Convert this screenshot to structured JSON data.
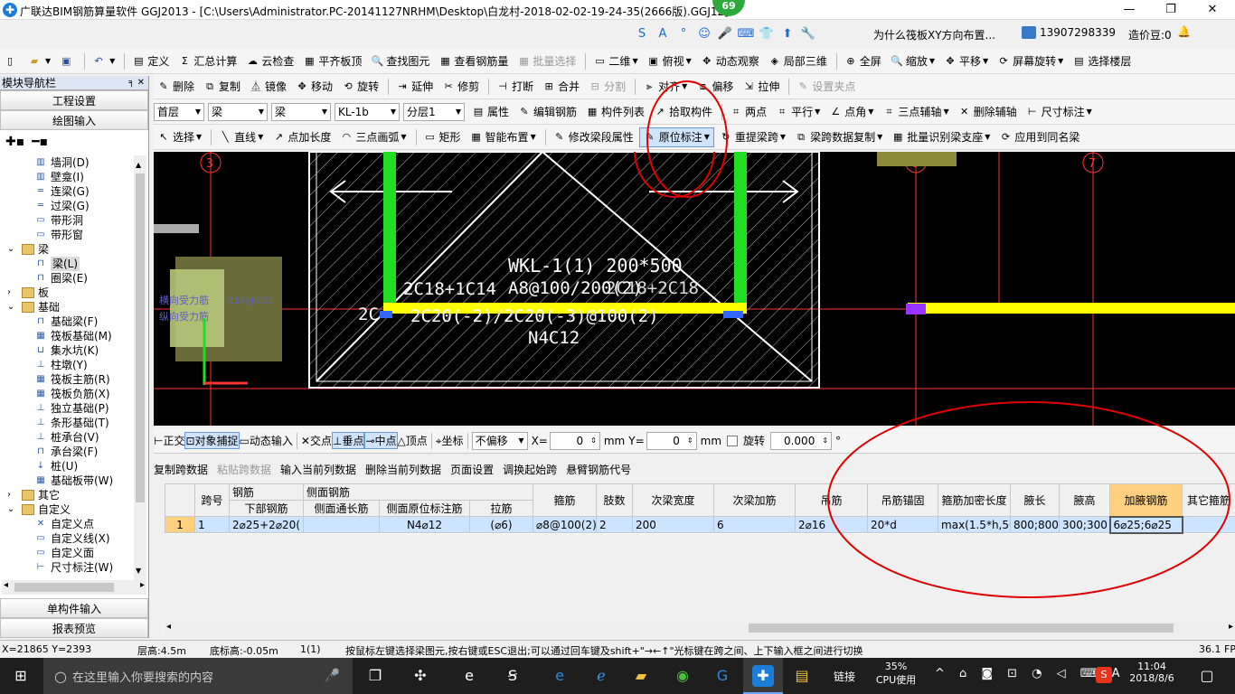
{
  "window": {
    "title": "广联达BIM钢筋算量软件 GGJ2013 - [C:\\Users\\Administrator.PC-20141127NRHM\\Desktop\\白龙村-2018-02-02-19-24-35(2666版).GGJ12]",
    "badge": "69",
    "min": "—",
    "max": "❐",
    "close": "✕"
  },
  "ime": {
    "icons": [
      "S",
      "A",
      "°",
      "☺",
      "🎤",
      "⌨",
      "👕",
      "⬆",
      "🔧"
    ]
  },
  "top_right": {
    "question": "为什么筏板XY方向布置...",
    "phone": "13907298339",
    "beans": "造价豆:0"
  },
  "menu": {
    "items": [
      {
        "label": "定义",
        "icon": "▤"
      },
      {
        "label": "汇总计算",
        "icon": "Σ"
      },
      {
        "label": "云检查",
        "icon": "☁"
      },
      {
        "label": "平齐板顶",
        "icon": "▦"
      },
      {
        "label": "查找图元",
        "icon": "🔍"
      },
      {
        "label": "查看钢筋量",
        "icon": "▦"
      },
      {
        "label": "批量选择",
        "icon": "▦"
      },
      {
        "label": "二维",
        "icon": "▭"
      },
      {
        "label": "俯视",
        "icon": "▣"
      },
      {
        "label": "动态观察",
        "icon": "✥"
      },
      {
        "label": "局部三维",
        "icon": "◈"
      },
      {
        "label": "全屏",
        "icon": "⊕"
      },
      {
        "label": "缩放",
        "icon": "🔍"
      },
      {
        "label": "平移",
        "icon": "✥"
      },
      {
        "label": "屏幕旋转",
        "icon": "⟳"
      },
      {
        "label": "选择楼层",
        "icon": "▤"
      }
    ]
  },
  "edit": {
    "items": [
      {
        "label": "删除",
        "icon": "✎"
      },
      {
        "label": "复制",
        "icon": "⧉"
      },
      {
        "label": "镜像",
        "icon": "⏅"
      },
      {
        "label": "移动",
        "icon": "✥"
      },
      {
        "label": "旋转",
        "icon": "⟲"
      },
      {
        "label": "延伸",
        "icon": "⇥"
      },
      {
        "label": "修剪",
        "icon": "✂"
      },
      {
        "label": "打断",
        "icon": "⊣"
      },
      {
        "label": "合并",
        "icon": "⊞"
      },
      {
        "label": "分割",
        "icon": "⊟"
      },
      {
        "label": "对齐",
        "icon": "⫸"
      },
      {
        "label": "偏移",
        "icon": "⧈"
      },
      {
        "label": "拉伸",
        "icon": "⇲"
      },
      {
        "label": "设置夹点",
        "icon": "✎"
      }
    ]
  },
  "props": {
    "floor": "首层",
    "cat1": "梁",
    "cat2": "梁",
    "comp": "KL-1b",
    "layer": "分层1",
    "items": [
      {
        "label": "属性",
        "icon": "▤"
      },
      {
        "label": "编辑钢筋",
        "icon": "✎"
      },
      {
        "label": "构件列表",
        "icon": "▦"
      },
      {
        "label": "拾取构件",
        "icon": "↗"
      },
      {
        "label": "两点",
        "icon": "⌗"
      },
      {
        "label": "平行",
        "icon": "⌗"
      },
      {
        "label": "点角",
        "icon": "∠"
      },
      {
        "label": "三点辅轴",
        "icon": "⌗"
      },
      {
        "label": "删除辅轴",
        "icon": "✕"
      },
      {
        "label": "尺寸标注",
        "icon": "⊢"
      }
    ]
  },
  "draw": {
    "items": [
      {
        "label": "选择",
        "icon": "↖"
      },
      {
        "label": "直线",
        "icon": "╲"
      },
      {
        "label": "点加长度",
        "icon": "↗"
      },
      {
        "label": "三点画弧",
        "icon": "◠"
      },
      {
        "label": "矩形",
        "icon": "▭"
      },
      {
        "label": "智能布置",
        "icon": "▦"
      },
      {
        "label": "修改梁段属性",
        "icon": "✎"
      },
      {
        "label": "原位标注",
        "icon": "✎"
      },
      {
        "label": "重提梁跨",
        "icon": "↻"
      },
      {
        "label": "梁跨数据复制",
        "icon": "⧉"
      },
      {
        "label": "批量识别梁支座",
        "icon": "▦"
      },
      {
        "label": "应用到同名梁",
        "icon": "⟳"
      }
    ]
  },
  "nav": {
    "title": "模块导航栏",
    "pin": "╕ ✕",
    "btn1": "工程设置",
    "btn2": "绘图输入",
    "btn3": "单构件输入",
    "btn4": "报表预览",
    "tree": [
      {
        "label": "墙洞(D)",
        "icon": "▥",
        "indent": 2
      },
      {
        "label": "壁龛(I)",
        "icon": "▥",
        "indent": 2
      },
      {
        "label": "连梁(G)",
        "icon": "═",
        "indent": 2
      },
      {
        "label": "过梁(G)",
        "icon": "═",
        "indent": 2
      },
      {
        "label": "带形洞",
        "icon": "▭",
        "indent": 2
      },
      {
        "label": "带形窗",
        "icon": "▭",
        "indent": 2
      },
      {
        "label": "梁",
        "icon": "",
        "indent": 1,
        "folder": true,
        "toggle": "⌄"
      },
      {
        "label": "梁(L)",
        "icon": "⊓",
        "indent": 2,
        "sel": true
      },
      {
        "label": "圈梁(E)",
        "icon": "⊓",
        "indent": 2
      },
      {
        "label": "板",
        "icon": "",
        "indent": 1,
        "folder": true,
        "toggle": "›"
      },
      {
        "label": "基础",
        "icon": "",
        "indent": 1,
        "folder": true,
        "toggle": "⌄"
      },
      {
        "label": "基础梁(F)",
        "icon": "⊓",
        "indent": 2
      },
      {
        "label": "筏板基础(M)",
        "icon": "▦",
        "indent": 2
      },
      {
        "label": "集水坑(K)",
        "icon": "⊔",
        "indent": 2
      },
      {
        "label": "柱墩(Y)",
        "icon": "⊥",
        "indent": 2
      },
      {
        "label": "筏板主筋(R)",
        "icon": "▦",
        "indent": 2
      },
      {
        "label": "筏板负筋(X)",
        "icon": "▦",
        "indent": 2
      },
      {
        "label": "独立基础(P)",
        "icon": "⊥",
        "indent": 2
      },
      {
        "label": "条形基础(T)",
        "icon": "⊥",
        "indent": 2
      },
      {
        "label": "桩承台(V)",
        "icon": "⊥",
        "indent": 2
      },
      {
        "label": "承台梁(F)",
        "icon": "⊓",
        "indent": 2
      },
      {
        "label": "桩(U)",
        "icon": "↓",
        "indent": 2
      },
      {
        "label": "基础板带(W)",
        "icon": "▦",
        "indent": 2
      },
      {
        "label": "其它",
        "icon": "",
        "indent": 1,
        "folder": true,
        "toggle": "›"
      },
      {
        "label": "自定义",
        "icon": "",
        "indent": 1,
        "folder": true,
        "toggle": "⌄"
      },
      {
        "label": "自定义点",
        "icon": "✕",
        "indent": 2
      },
      {
        "label": "自定义线(X)",
        "icon": "▭",
        "indent": 2
      },
      {
        "label": "自定义面",
        "icon": "▭",
        "indent": 2
      },
      {
        "label": "尺寸标注(W)",
        "icon": "⊢",
        "indent": 2
      }
    ]
  },
  "canvas": {
    "axes": [
      "3",
      "4",
      "6",
      "7"
    ],
    "beam_label": "WKL-1(1) 200*500",
    "stirrup": "A8@100/200(2)",
    "top_bars": "2C18+1C14",
    "top_bars2": "2C18+2C18",
    "bottom_bars": "2C20(-2)/2C20(-3)@100(2)",
    "bottom_prefix": "2C",
    "side": "N4C12",
    "pile_labels": [
      "横向受力筋",
      "纵向受力筋",
      "C14@100"
    ]
  },
  "snap": {
    "items": [
      {
        "label": "正交",
        "icon": "⊢"
      },
      {
        "label": "对象捕捉",
        "icon": "⊡"
      },
      {
        "label": "动态输入",
        "icon": "▭"
      },
      {
        "label": "交点",
        "icon": "✕"
      },
      {
        "label": "垂点",
        "icon": "⊥"
      },
      {
        "label": "中点",
        "icon": "⊸"
      },
      {
        "label": "顶点",
        "icon": "△"
      },
      {
        "label": "坐标",
        "icon": "⌖"
      }
    ],
    "offset": "不偏移",
    "x_label": "X=",
    "x_val": "0",
    "y_label": "Y=",
    "y_val": "0",
    "mm": "mm",
    "rotate_label": "旋转",
    "rotate_val": "0.000",
    "deg": "°"
  },
  "grid_tb": {
    "items": [
      "复制跨数据",
      "粘贴跨数据",
      "输入当前列数据",
      "删除当前列数据",
      "页面设置",
      "调换起始跨",
      "悬臂钢筋代号"
    ]
  },
  "table": {
    "h1": [
      "跨号",
      "钢筋",
      "侧面钢筋",
      "箍筋",
      "肢数",
      "次梁宽度",
      "次梁加筋",
      "吊筋",
      "吊筋锚固",
      "箍筋加密长度",
      "腋长",
      "腋高",
      "加腋钢筋",
      "其它箍筋"
    ],
    "h2": [
      "下部钢筋",
      "侧面通长筋",
      "侧面原位标注筋",
      "拉筋"
    ],
    "row": [
      "1",
      "1",
      "2⌀25+2⌀20(",
      "",
      "N4⌀12",
      "(⌀6)",
      "⌀8@100(2)",
      "2",
      "200",
      "6",
      "2⌀16",
      "20*d",
      "max(1.5*h,50",
      "800;800",
      "300;300",
      "6⌀25;6⌀25",
      ""
    ]
  },
  "status": {
    "coords": "X=21865 Y=2393",
    "floor_h": "层高:4.5m",
    "base_h": "底标高:-0.05m",
    "count": "1(1)",
    "hint": "按鼠标左键选择梁图元,按右键或ESC退出;可以通过回车键及shift+\"→←↑\"光标键在跨之间、上下输入框之间进行切换",
    "fps": "36.1 FPS"
  },
  "taskbar": {
    "search": "在这里输入你要搜索的内容",
    "link": "链接",
    "cpu": "35%",
    "cpu_label": "CPU使用",
    "time": "11:04",
    "date": "2018/8/6"
  },
  "colors": {
    "canvas": "#000000",
    "beam_green": "#22dd22",
    "beam_yellow": "#ffff00",
    "axis_red": "#ff3333",
    "annot_red": "#e00000",
    "highlight": "#ffd080",
    "selected_row": "#cce4ff"
  }
}
